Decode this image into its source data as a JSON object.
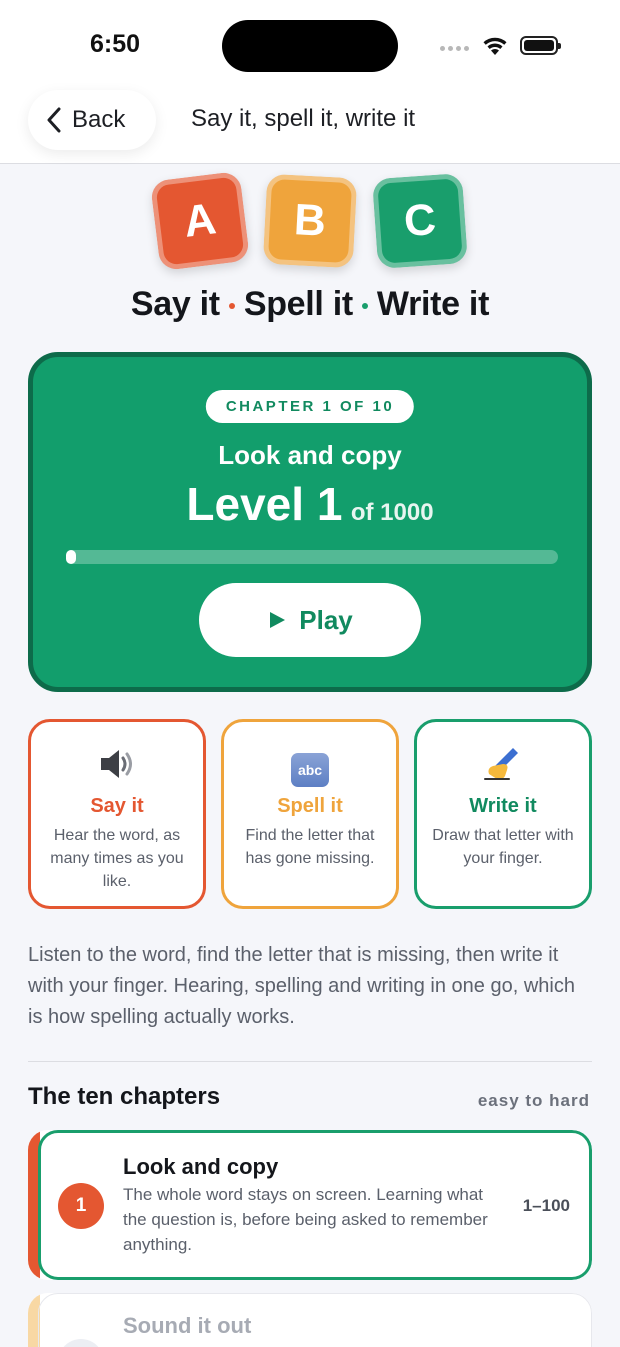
{
  "status_bar": {
    "time": "6:50"
  },
  "nav": {
    "back_label": "Back",
    "title": "Say it, spell it, write it"
  },
  "logo": {
    "tiles": [
      "A",
      "B",
      "C"
    ],
    "colors": [
      "#e45731",
      "#efa43c",
      "#199e6c"
    ]
  },
  "tagline": {
    "parts": [
      "Say it",
      "Spell it",
      "Write it"
    ]
  },
  "hero": {
    "chapter_label": "CHAPTER 1 OF 10",
    "chapter_name": "Look and copy",
    "level_label": "Level 1",
    "level_total": "of 1000",
    "progress": 0.0,
    "play_label": "Play",
    "color": "#129e6c"
  },
  "modes": [
    {
      "icon": "speaker-icon",
      "glyph": "🔊",
      "title": "Say it",
      "desc": "Hear the word, as many times as you like."
    },
    {
      "icon": "abc-icon",
      "glyph": "abc",
      "title": "Spell it",
      "desc": "Find the letter that has gone missing."
    },
    {
      "icon": "writing-hand-icon",
      "glyph": "✍️",
      "title": "Write it",
      "desc": "Draw that letter with your finger."
    }
  ],
  "intro": "Listen to the word, find the letter that is missing, then write it with your finger. Hearing, spelling and writing in one go, which is how spelling actually works.",
  "chapters_section": {
    "title": "The ten chapters",
    "note": "easy to hard"
  },
  "chapters": [
    {
      "number": "1",
      "title": "Look and copy",
      "desc": "The whole word stays on screen. Learning what the question is, before being asked to remember anything.",
      "range": "1–100"
    },
    {
      "number": "",
      "title": "Sound it out",
      "desc": "",
      "range": ""
    }
  ]
}
